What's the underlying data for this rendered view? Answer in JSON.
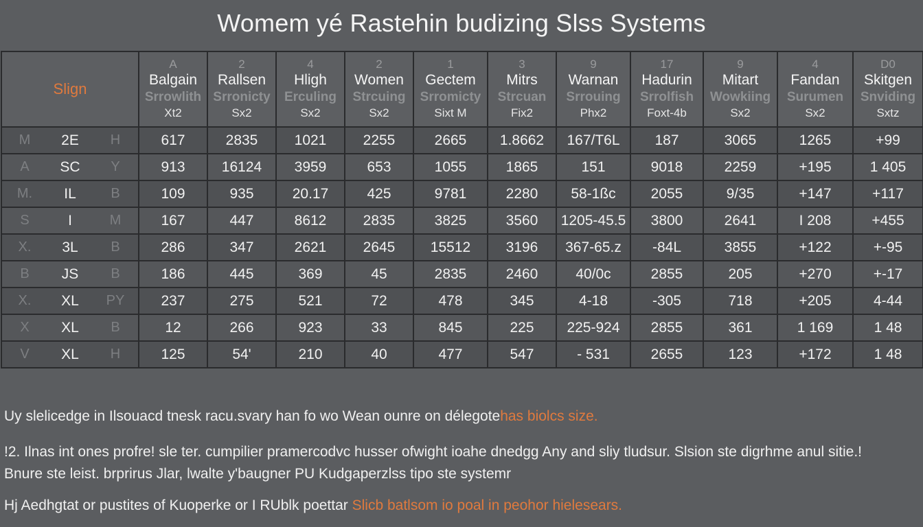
{
  "title": "Womem yé Rastehin budizing Slss Systems",
  "size_header": "Slign",
  "columns": [
    {
      "num": "A",
      "name": "Balgain",
      "sub": "Srrowlith",
      "unit": "Xt2"
    },
    {
      "num": "2",
      "name": "Rallsen",
      "sub": "Srronicty",
      "unit": "Sx2"
    },
    {
      "num": "4",
      "name": "Hligh",
      "sub": "Erculing",
      "unit": "Sx2"
    },
    {
      "num": "2",
      "name": "Women",
      "sub": "Strcuing",
      "unit": "Sx2"
    },
    {
      "num": "1",
      "name": "Gectem",
      "sub": "Srromicty",
      "unit": "Sixt M"
    },
    {
      "num": "3",
      "name": "Mitrs",
      "sub": "Strcuan",
      "unit": "Fix2"
    },
    {
      "num": "9",
      "name": "Warnan",
      "sub": "Srrouing",
      "unit": "Phx2"
    },
    {
      "num": "17",
      "name": "Hadurin",
      "sub": "Srrolfish",
      "unit": "Foxt-4b"
    },
    {
      "num": "9",
      "name": "Mitart",
      "sub": "Wowkiing",
      "unit": "Sx2"
    },
    {
      "num": "4",
      "name": "Fandan",
      "sub": "Surumen",
      "unit": "Sx2"
    },
    {
      "num": "D0",
      "name": "Skitgen",
      "sub": "Snviding",
      "unit": "Sxtz"
    }
  ],
  "rows": [
    {
      "a": "M",
      "b": "2E",
      "c": "H",
      "values": [
        "617",
        "2835",
        "1021",
        "2255",
        "2665",
        "1.8662",
        "167/T6L",
        "187",
        "3065",
        "1265",
        "+99"
      ]
    },
    {
      "a": "A",
      "b": "SC",
      "c": "Y",
      "values": [
        "913",
        "16124",
        "3959",
        "653",
        "1055",
        "1865",
        "151",
        "9018",
        "2259",
        "+195",
        "1 405"
      ]
    },
    {
      "a": "M.",
      "b": "IL",
      "c": "B",
      "values": [
        "109",
        "935",
        "20.17",
        "425",
        "9781",
        "2280",
        "58-1ßc",
        "2055",
        "9/35",
        "+147",
        "+117"
      ]
    },
    {
      "a": "S",
      "b": "I",
      "c": "M",
      "values": [
        "167",
        "447",
        "8612",
        "2835",
        "3825",
        "3560",
        "1205-45.5",
        "3800",
        "2641",
        "I 208",
        "+455"
      ]
    },
    {
      "a": "X.",
      "b": "3L",
      "c": "B",
      "values": [
        "286",
        "347",
        "2621",
        "2645",
        "15512",
        "3196",
        "367-65.z",
        "-84L",
        "3855",
        "+122",
        "+-95"
      ]
    },
    {
      "a": "B",
      "b": "JS",
      "c": "B",
      "values": [
        "186",
        "445",
        "369",
        "45",
        "2835",
        "2460",
        "40/0c",
        "2855",
        "205",
        "+270",
        "+-17"
      ]
    },
    {
      "a": "X.",
      "b": "XL",
      "c": "PY",
      "values": [
        "237",
        "275",
        "521",
        "72",
        "478",
        "345",
        "4-18",
        "-305",
        "718",
        "+205",
        "4-44"
      ]
    },
    {
      "a": "X",
      "b": "XL",
      "c": "B",
      "values": [
        "12",
        "266",
        "923",
        "33",
        "845",
        "225",
        "225-924",
        "2855",
        "361",
        "1 169",
        "1 48"
      ]
    },
    {
      "a": "V",
      "b": "XL",
      "c": "H",
      "values": [
        "125",
        "54'",
        "210",
        "40",
        "477",
        "547",
        "- 531",
        "2655",
        "123",
        "+172",
        "1 48"
      ]
    }
  ],
  "notes": {
    "n1_main": "Uy slelicedge in Ilsouacd tnesk racu.svary han fo wo Wean ounre on délegote",
    "n1_accent": "has biolcs size.",
    "n2": "!2. Ilnas int ones profre! sle ter. cumpilier pramercodvc husser ofwight ioahe dnedgg Any and sliy tludsur. Slsion ste digrhme anul sitie.!",
    "n3": "Bnure ste leist. brprirus Jlar, lwalte y'baugner PU Kudgaperzlss tipo ste systemr",
    "n4_main": "Hj Aedhgtat or pustites of Kuoperke or I RUblk poettar",
    "n4_accent": "Slicb batlsom io poal in peohor hielesears."
  }
}
